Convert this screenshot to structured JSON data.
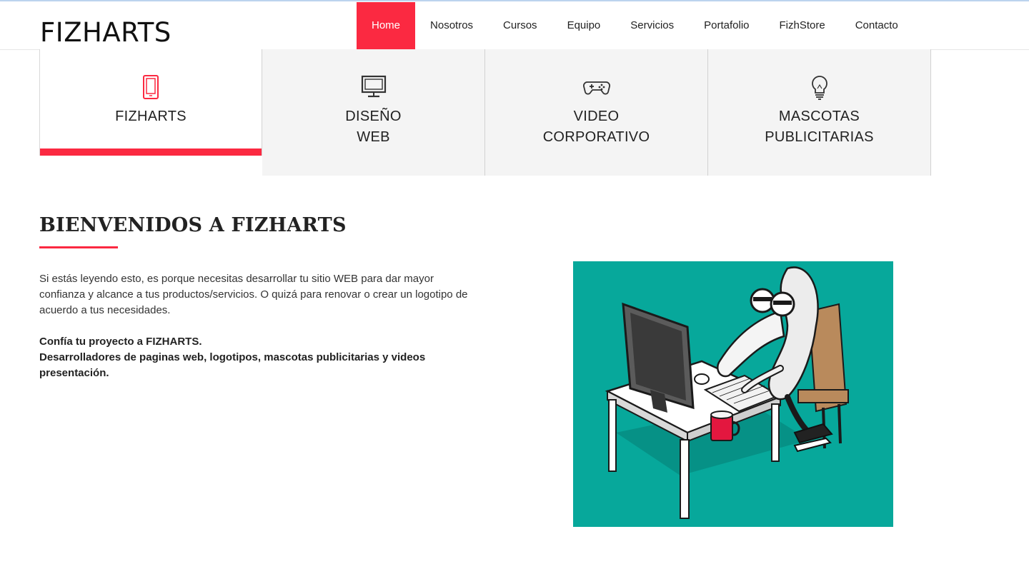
{
  "brand": {
    "name": "FIZHARTS"
  },
  "nav": [
    {
      "label": "Home",
      "active": true
    },
    {
      "label": "Nosotros"
    },
    {
      "label": "Cursos"
    },
    {
      "label": "Equipo"
    },
    {
      "label": "Servicios"
    },
    {
      "label": "Portafolio"
    },
    {
      "label": "FizhStore"
    },
    {
      "label": "Contacto"
    }
  ],
  "tabs": [
    {
      "line1": "FIZHARTS",
      "line2": "",
      "icon": "tablet-icon"
    },
    {
      "line1": "DISEÑO",
      "line2": "WEB",
      "icon": "monitor-icon"
    },
    {
      "line1": "VIDEO",
      "line2": "CORPORATIVO",
      "icon": "gamepad-icon"
    },
    {
      "line1": "MASCOTAS",
      "line2": "PUBLICITARIAS",
      "icon": "lightbulb-icon"
    }
  ],
  "welcome": {
    "title": "BIENVENIDOS A FIZHARTS",
    "intro": "Si estás leyendo esto, es porque necesitas desarrollar tu sitio WEB para dar mayor confianza y alcance a tus productos/servicios. O quizá para renovar o crear un logotipo de acuerdo a tus necesidades.",
    "strong_line1": "Confía tu proyecto a FIZHARTS.",
    "strong_line2": "Desarrolladores de paginas web, logotipos, mascotas publicitarias y videos presentación."
  },
  "colors": {
    "accent": "#fb2941",
    "art_bg": "#07a89b",
    "tab_bg": "#f4f4f4"
  }
}
